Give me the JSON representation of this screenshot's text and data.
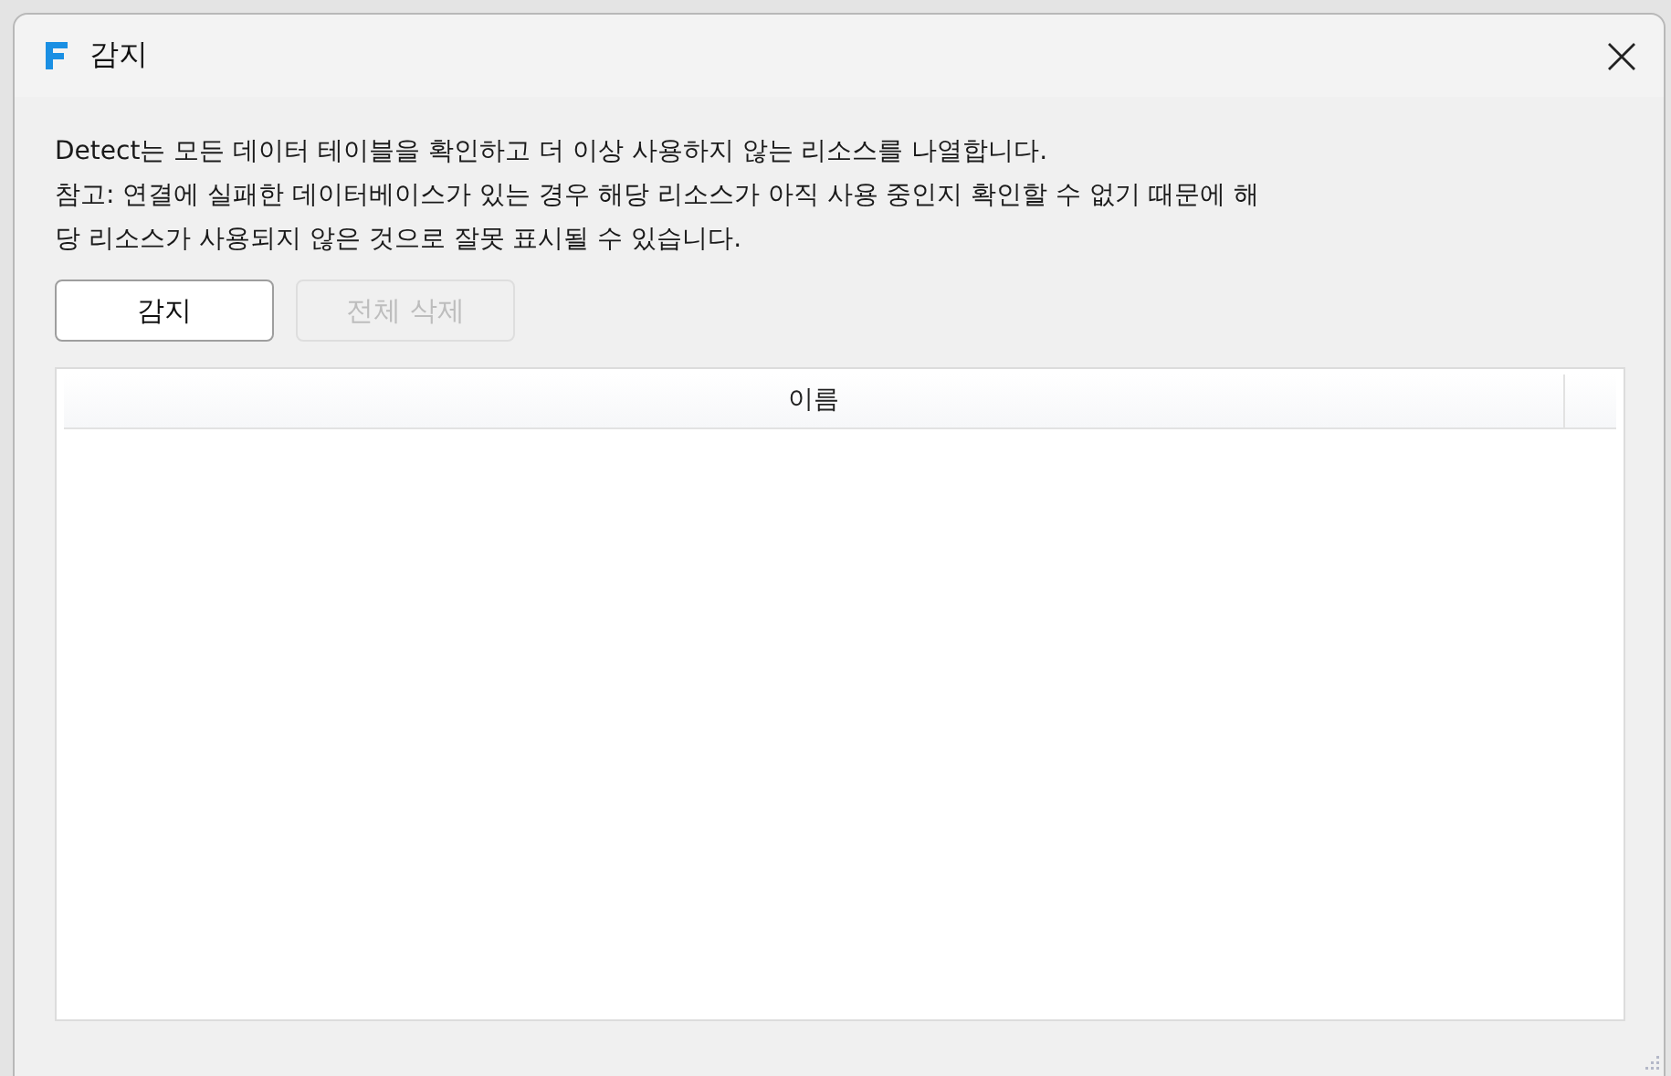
{
  "window": {
    "title": "감지"
  },
  "description_lines": [
    "Detect는 모든 데이터 테이블을 확인하고 더 이상 사용하지 않는 리소스를 나열합니다.",
    "참고: 연결에 실패한 데이터베이스가 있는 경우 해당 리소스가 아직 사용 중인지 확인할 수 없기 때문에 해",
    "당 리소스가 사용되지 않은 것으로 잘못 표시될 수 있습니다."
  ],
  "buttons": [
    {
      "label": "감지",
      "disabled": false
    },
    {
      "label": "전체 삭제",
      "disabled": true
    }
  ],
  "table": {
    "columns": [
      "이름"
    ]
  }
}
